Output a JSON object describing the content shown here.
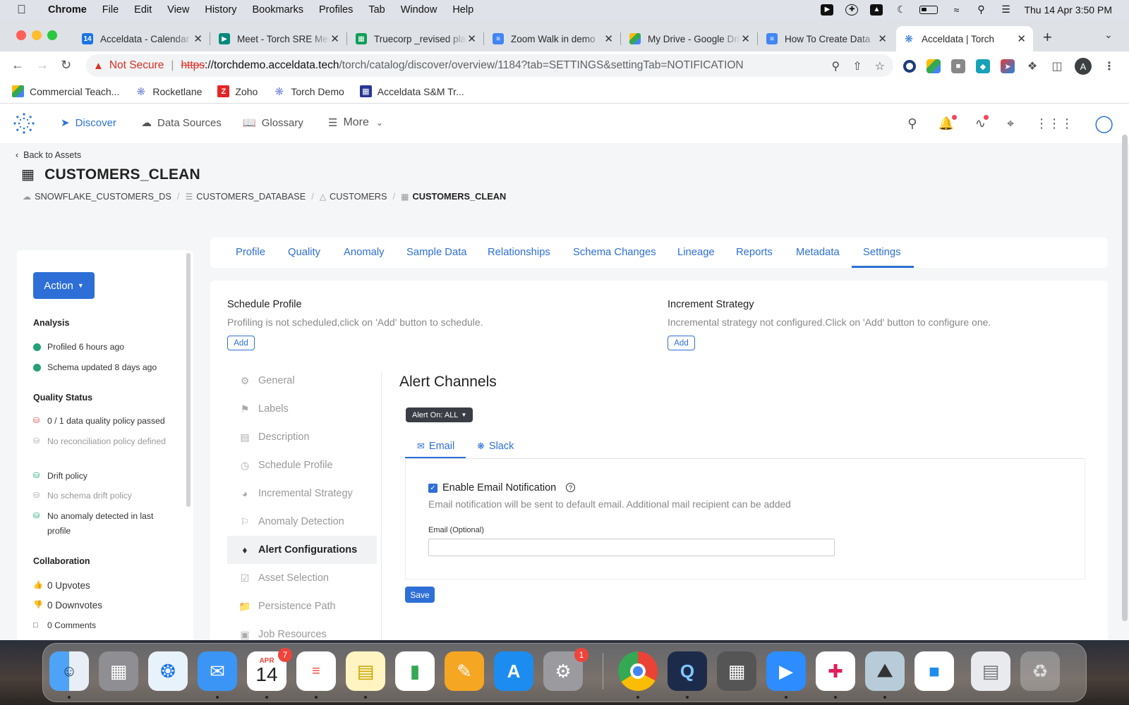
{
  "menubar": {
    "app": "Chrome",
    "items": [
      "File",
      "Edit",
      "View",
      "History",
      "Bookmarks",
      "Profiles",
      "Tab",
      "Window",
      "Help"
    ],
    "datetime": "Thu 14 Apr  3:50 PM"
  },
  "browser": {
    "tabs": [
      {
        "title": "Acceldata - Calendar",
        "icon": "calendar-icon",
        "color": "#1a73e8"
      },
      {
        "title": "Meet - Torch SRE Meeting",
        "icon": "meet-icon",
        "color": "#00897b"
      },
      {
        "title": "Truecorp _revised plan",
        "icon": "sheets-icon",
        "color": "#0f9d58"
      },
      {
        "title": "Zoom Walk in demo",
        "icon": "docs-icon",
        "color": "#4285f4"
      },
      {
        "title": "My Drive - Google Drive",
        "icon": "drive-icon",
        "color": "#fbbc04"
      },
      {
        "title": "How To Create Data",
        "icon": "docs-icon",
        "color": "#4285f4"
      },
      {
        "title": "Acceldata | Torch",
        "icon": "torch-icon",
        "color": "#2a74d8"
      }
    ],
    "address": {
      "not_secure": "Not Secure",
      "scheme": "https",
      "host": "://torchdemo.acceldata.tech",
      "path": "/torch/catalog/discover/overview/1184?tab=SETTINGS&settingTab=NOTIFICATION"
    },
    "profile_initial": "A",
    "bookmarks": [
      {
        "label": "Commercial Teach...",
        "icon": "drive-icon"
      },
      {
        "label": "Rocketlane",
        "icon": "rocketlane-icon"
      },
      {
        "label": "Zoho",
        "icon": "zoho-icon"
      },
      {
        "label": "Torch Demo",
        "icon": "torch-icon"
      },
      {
        "label": "Acceldata S&M Tr...",
        "icon": "acceldata-icon"
      }
    ]
  },
  "appnav": {
    "items": [
      {
        "label": "Discover",
        "icon": "compass-icon"
      },
      {
        "label": "Data Sources",
        "icon": "cloud-icon"
      },
      {
        "label": "Glossary",
        "icon": "book-icon"
      },
      {
        "label": "More",
        "icon": "menu-icon"
      }
    ]
  },
  "asset": {
    "back": "Back to Assets",
    "title": "CUSTOMERS_CLEAN",
    "breadcrumb": [
      "SNOWFLAKE_CUSTOMERS_DS",
      "CUSTOMERS_DATABASE",
      "CUSTOMERS",
      "CUSTOMERS_CLEAN"
    ]
  },
  "sidebar": {
    "action": "Action",
    "analysis_h": "Analysis",
    "analysis": [
      "Profiled 6 hours ago",
      "Schema updated 8 days ago"
    ],
    "quality_h": "Quality Status",
    "quality": [
      "0 / 1 data quality policy passed",
      "No reconciliation policy defined",
      "Drift policy",
      "No schema drift policy",
      "No anomaly detected in last profile"
    ],
    "collab_h": "Collaboration",
    "collab": [
      "0 Upvotes",
      "0 Downvotes",
      "0 Comments"
    ]
  },
  "tabs": [
    "Profile",
    "Quality",
    "Anomaly",
    "Sample Data",
    "Relationships",
    "Schema Changes",
    "Lineage",
    "Reports",
    "Metadata",
    "Settings"
  ],
  "schedule": {
    "title": "Schedule Profile",
    "desc": "Profiling is not scheduled,click on 'Add' button to schedule.",
    "add": "Add"
  },
  "increment": {
    "title": "Increment Strategy",
    "desc": "Incremental strategy not configured.Click on 'Add' button to configure one.",
    "add": "Add"
  },
  "settings_menu": [
    "General",
    "Labels",
    "Description",
    "Schedule Profile",
    "Incremental Strategy",
    "Anomaly Detection",
    "Alert Configurations",
    "Asset Selection",
    "Persistence Path",
    "Job Resources"
  ],
  "alerts": {
    "title": "Alert Channels",
    "alert_on": "Alert On: ALL",
    "subtabs": [
      "Email",
      "Slack"
    ],
    "enable_label": "Enable Email Notification",
    "enable_desc": "Email notification will be sent to default email. Additional mail recipient can be added",
    "email_label": "Email (Optional)",
    "email_value": "",
    "save": "Save"
  },
  "dock": {
    "calendar_month": "APR",
    "calendar_day": "14",
    "calendar_badge": "7",
    "settings_badge": "1"
  }
}
